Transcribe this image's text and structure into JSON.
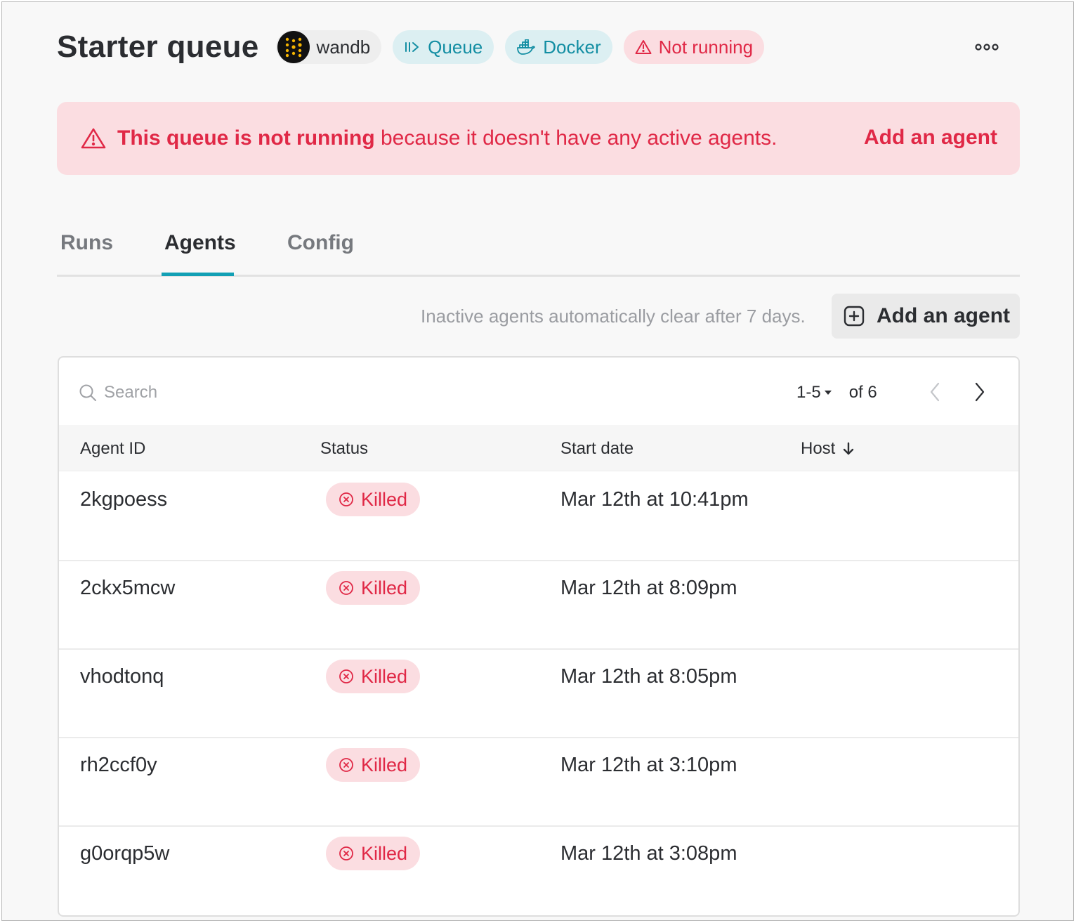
{
  "header": {
    "title": "Starter queue",
    "entity": {
      "name": "wandb",
      "icon": "wandb-logo-icon"
    },
    "type_pill": {
      "label": "Queue",
      "icon": "queue-icon"
    },
    "resource_pill": {
      "label": "Docker",
      "icon": "docker-icon"
    },
    "status_pill": {
      "label": "Not running",
      "icon": "warning-icon"
    },
    "more_icon": "more-options-icon"
  },
  "banner": {
    "icon": "warning-icon",
    "bold_text": "This queue is not running",
    "text": " because it doesn't have any active agents.",
    "link": "Add an agent"
  },
  "tabs": [
    {
      "label": "Runs",
      "active": false
    },
    {
      "label": "Agents",
      "active": true
    },
    {
      "label": "Config",
      "active": false
    }
  ],
  "toolbar": {
    "hint": "Inactive agents automatically clear after 7 days.",
    "add_button": "Add an agent",
    "add_icon": "plus-square-icon"
  },
  "table": {
    "search_placeholder": "Search",
    "pagination": {
      "range": "1-5",
      "total": "of 6"
    },
    "columns": [
      "Agent ID",
      "Status",
      "Start date",
      "Host"
    ],
    "sort_icon": "arrow-down-icon",
    "rows": [
      {
        "agent_id": "2kgpoess",
        "status": "Killed",
        "start_date": "Mar 12th at 10:41pm",
        "host": ""
      },
      {
        "agent_id": "2ckx5mcw",
        "status": "Killed",
        "start_date": "Mar 12th at 8:09pm",
        "host": ""
      },
      {
        "agent_id": "vhodtonq",
        "status": "Killed",
        "start_date": "Mar 12th at 8:05pm",
        "host": ""
      },
      {
        "agent_id": "rh2ccf0y",
        "status": "Killed",
        "start_date": "Mar 12th at 3:10pm",
        "host": ""
      },
      {
        "agent_id": "g0orqp5w",
        "status": "Killed",
        "start_date": "Mar 12th at 3:08pm",
        "host": ""
      }
    ]
  },
  "colors": {
    "accent_teal": "#13a0b5",
    "danger": "#e02846",
    "danger_bg": "#fbdde1",
    "teal_bg": "#dceff2"
  }
}
